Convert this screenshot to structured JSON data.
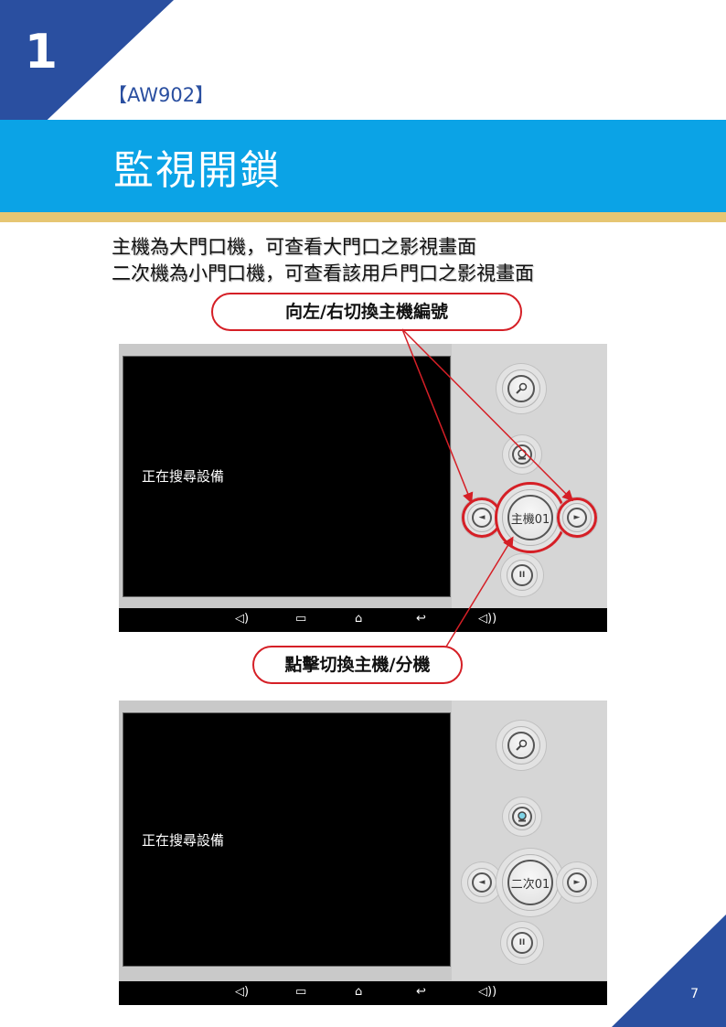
{
  "header": {
    "chapter_number": "1",
    "model": "【AW902】",
    "title": "監視開鎖"
  },
  "description": {
    "line1": "主機為大門口機，可查看大門口之影視畫面",
    "line2": "二次機為小門口機，可查看該用戶門口之影視畫面"
  },
  "callouts": {
    "switch_host_number": "向左/右切換主機編號",
    "tap_switch": "點擊切換主機/分機"
  },
  "screen1": {
    "status_text": "正在搜尋設備",
    "center_button_label": "主機01"
  },
  "screen2": {
    "status_text": "正在搜尋設備",
    "center_button_label": "二次01"
  },
  "footer": {
    "page_number": "7"
  },
  "colors": {
    "accent_blue": "#0ba3e6",
    "dark_blue": "#2a4fa0",
    "gold": "#e6c673",
    "highlight_red": "#d51f26"
  },
  "icons": [
    "microphone-icon",
    "camera-icon",
    "left-arrow-icon",
    "right-arrow-icon",
    "pause-icon",
    "volume-down-icon",
    "recent-apps-icon",
    "home-icon",
    "back-icon",
    "volume-up-icon"
  ]
}
